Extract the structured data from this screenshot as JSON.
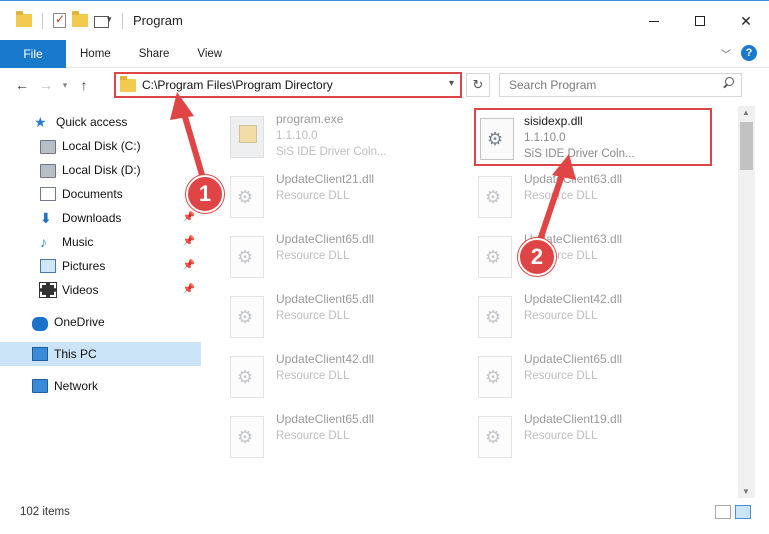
{
  "window": {
    "title": "Program"
  },
  "ribbon": {
    "tabs": [
      "File",
      "Home",
      "Share",
      "View"
    ],
    "help_label": "?"
  },
  "address": {
    "path": "C:\\Program Files\\Program Directory",
    "search_placeholder": "Search Program"
  },
  "sidebar": {
    "items": [
      {
        "label": "Quick access",
        "icon": "star-icon"
      },
      {
        "label": "Local Disk (C:)",
        "icon": "disk-icon"
      },
      {
        "label": "Local Disk (D:)",
        "icon": "disk-icon"
      },
      {
        "label": "Documents",
        "icon": "documents-icon"
      },
      {
        "label": "Downloads",
        "icon": "downloads-icon"
      },
      {
        "label": "Music",
        "icon": "music-icon"
      },
      {
        "label": "Pictures",
        "icon": "pictures-icon"
      },
      {
        "label": "Videos",
        "icon": "videos-icon"
      },
      {
        "label": "OneDrive",
        "icon": "cloud-icon"
      },
      {
        "label": "This PC",
        "icon": "computer-icon"
      },
      {
        "label": "Network",
        "icon": "network-icon"
      }
    ]
  },
  "files": [
    {
      "name": "program.exe",
      "line2": "1.1.10.0",
      "line3": "SiS IDE Driver Coln..."
    },
    {
      "name": "sisidexp.dll",
      "line2": "1.1.10.0",
      "line3": "SiS IDE Driver Coln..."
    },
    {
      "name": "UpdateClient21.dll",
      "line2": "Resource DLL"
    },
    {
      "name": "UpdateClient63.dll",
      "line2": "Resource DLL"
    },
    {
      "name": "UpdateClient65.dll",
      "line2": "Resource DLL"
    },
    {
      "name": "UpdateClient63.dll",
      "line2": "Resource DLL"
    },
    {
      "name": "UpdateClient65.dll",
      "line2": "Resource DLL"
    },
    {
      "name": "UpdateClient42.dll",
      "line2": "Resource DLL"
    },
    {
      "name": "UpdateClient42.dll",
      "line2": "Resource DLL"
    },
    {
      "name": "UpdateClient65.dll",
      "line2": "Resource DLL"
    },
    {
      "name": "UpdateClient65.dll",
      "line2": "Resource DLL"
    },
    {
      "name": "UpdateClient19.dll",
      "line2": "Resource DLL"
    }
  ],
  "callouts": [
    "1",
    "2"
  ],
  "status": {
    "item_count": "102 items"
  },
  "colors": {
    "accent": "#1979ca",
    "highlight": "#e04545",
    "selected_bg": "#cce4f7"
  }
}
